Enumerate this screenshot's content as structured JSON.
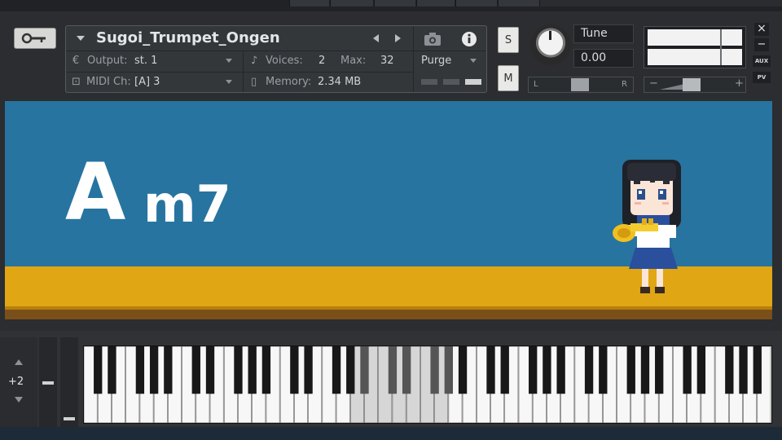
{
  "instrument": {
    "name": "Sugoi_Trumpet_Ongen",
    "output_label": "Output:",
    "output_value": "st. 1",
    "voices_label": "Voices:",
    "voices_value": "2",
    "max_label": "Max:",
    "max_value": "32",
    "midi_label": "MIDI Ch:",
    "midi_value": "[A] 3",
    "memory_label": "Memory:",
    "memory_value": "2.34 MB",
    "purge_label": "Purge"
  },
  "side_buttons": {
    "solo": "S",
    "mute": "M"
  },
  "tune": {
    "label": "Tune",
    "value": "0.00"
  },
  "pan": {
    "left": "L",
    "right": "R"
  },
  "volume": {
    "minus": "−",
    "plus": "+"
  },
  "window_controls": {
    "close": "×",
    "minimize": "−",
    "aux": "AUX",
    "pv": "PV"
  },
  "chord": {
    "root": "A",
    "quality": "m7"
  },
  "octave": {
    "value": "+2"
  },
  "colors": {
    "stage": "#2774a0",
    "floor": "#e0a614",
    "panel": "#2b2d30"
  },
  "icons": [
    "wrench-icon",
    "dropdown-arrow-icon",
    "prev-arrow-icon",
    "next-arrow-icon",
    "camera-icon",
    "info-icon",
    "output-icon",
    "voices-icon",
    "midi-icon",
    "memory-icon",
    "tune-knob-icon"
  ]
}
